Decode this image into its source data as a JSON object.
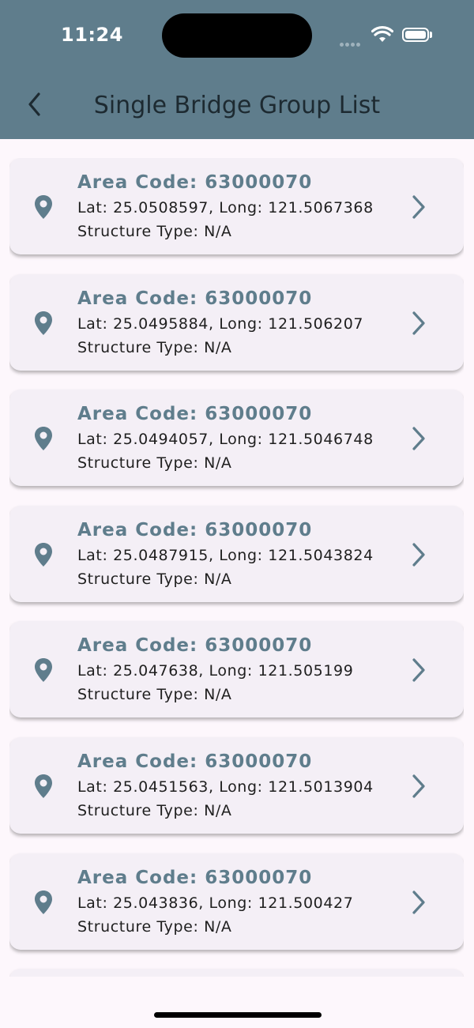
{
  "status_bar": {
    "time": "11:24"
  },
  "app_bar": {
    "title": "Single Bridge Group List"
  },
  "icons": {
    "back": "chevron-left-icon",
    "pin": "location-pin-icon",
    "chevron": "chevron-right-icon"
  },
  "colors": {
    "primary": "#5f7d8c",
    "card_bg": "#f4eff6",
    "page_bg": "#fdf7fc"
  },
  "items": [
    {
      "area": "Area Code: 63000070",
      "coords": "Lat: 25.0508597, Long: 121.5067368",
      "type": "Structure Type: N/A"
    },
    {
      "area": "Area Code: 63000070",
      "coords": "Lat: 25.0495884, Long: 121.506207",
      "type": "Structure Type: N/A"
    },
    {
      "area": "Area Code: 63000070",
      "coords": "Lat: 25.0494057, Long: 121.5046748",
      "type": "Structure Type: N/A"
    },
    {
      "area": "Area Code: 63000070",
      "coords": "Lat: 25.0487915, Long: 121.5043824",
      "type": "Structure Type: N/A"
    },
    {
      "area": "Area Code: 63000070",
      "coords": "Lat: 25.047638, Long: 121.505199",
      "type": "Structure Type: N/A"
    },
    {
      "area": "Area Code: 63000070",
      "coords": "Lat: 25.0451563, Long: 121.5013904",
      "type": "Structure Type: N/A"
    },
    {
      "area": "Area Code: 63000070",
      "coords": "Lat: 25.043836, Long: 121.500427",
      "type": "Structure Type: N/A"
    },
    {
      "area": "",
      "coords": "",
      "type": ""
    }
  ]
}
